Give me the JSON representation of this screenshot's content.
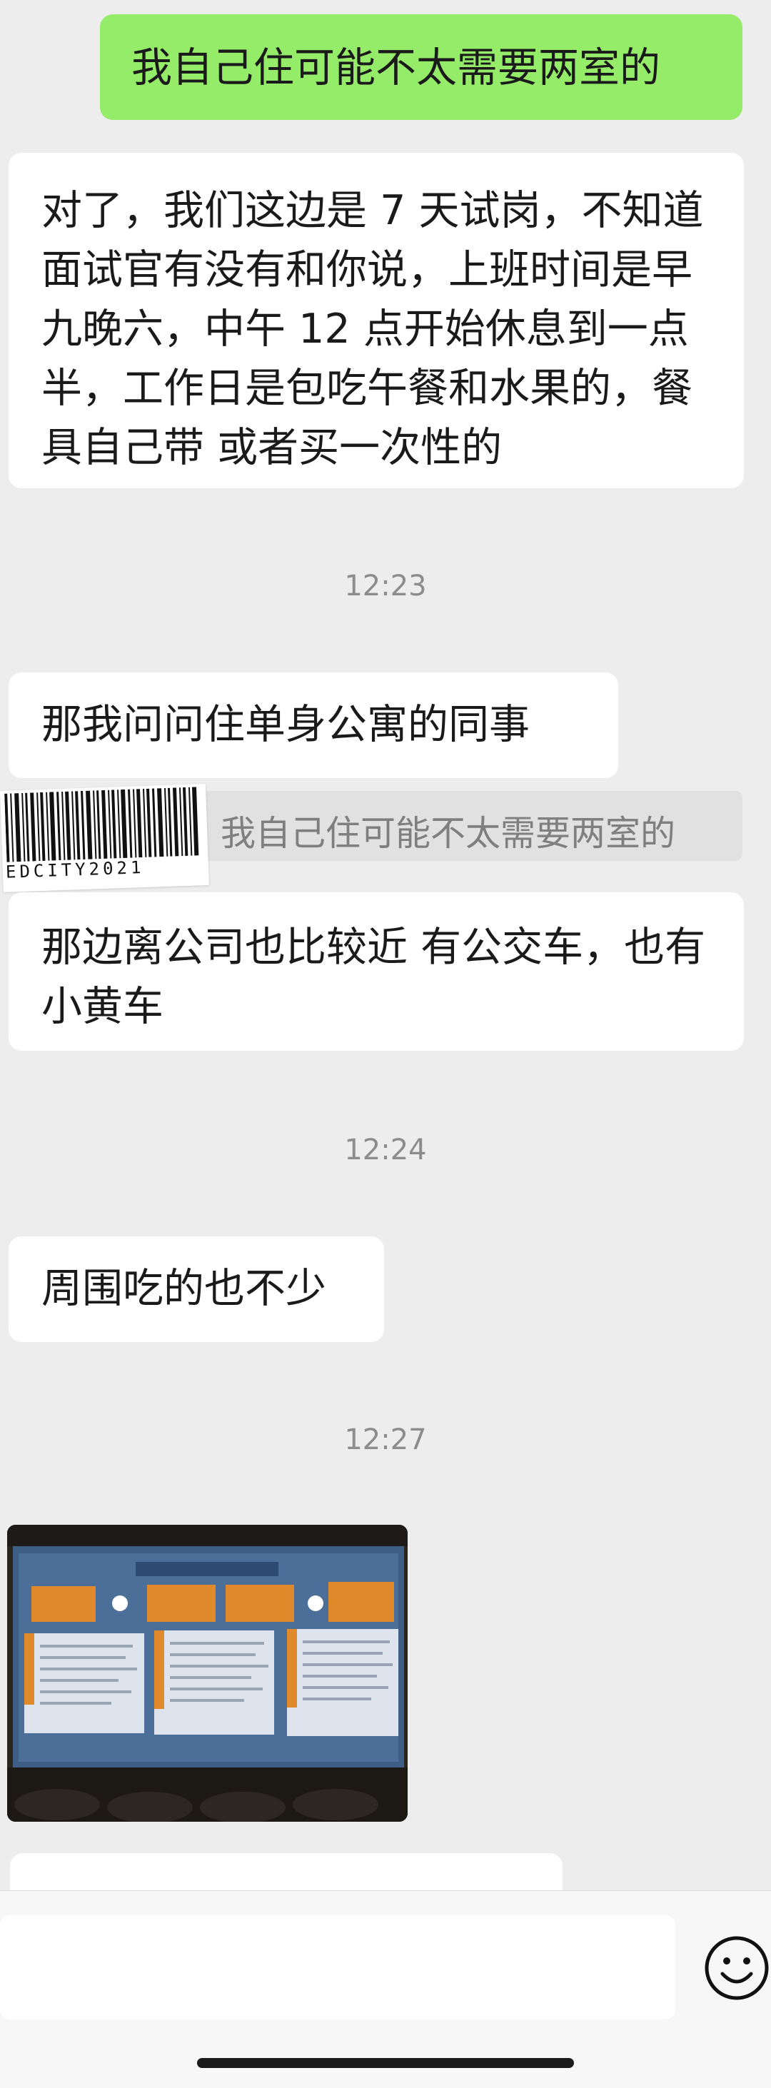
{
  "messages": {
    "m1": "我自己住可能不太需要两室的",
    "m2": "对了，我们这边是 7 天试岗，不知道面试官有没有和你说，上班时间是早九晚六，中午 12 点开始休息到一点半，工作日是包吃午餐和水果的，餐具自己带 或者买一次性的",
    "t1": "12:23",
    "m3": "那我问问住单身公寓的同事",
    "quote_text": "：我自己住可能不太需要两室的",
    "m4": "那边离公司也比较近 有公交车，也有小黄车",
    "t2": "12:24",
    "m5": "周围吃的也不少",
    "t3": "12:27"
  },
  "overlay": {
    "barcode_text": "EDCITY2021"
  },
  "icons": {
    "emoji_button": "smiley-icon"
  },
  "colors": {
    "background": "#ededed",
    "outgoing_bubble": "#95ec69",
    "incoming_bubble": "#ffffff"
  }
}
